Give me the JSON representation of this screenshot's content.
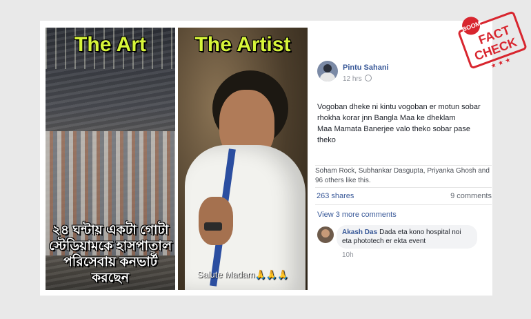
{
  "left_panel": {
    "title": "The Art",
    "caption_line1": "২৪ ঘন্টায় একটা গোটা",
    "caption_line2": "স্টেডিয়ামকে হাসপাতাল",
    "caption_line3": "পরিসেবায় কনভার্ট করছেন"
  },
  "right_panel": {
    "title": "The Artist",
    "caption": "Salute Madam🙏🙏🙏"
  },
  "post": {
    "author": "Pintu Sahani",
    "time": "12 hrs",
    "text_line1": "Vogoban dheke ni kintu vogoban er motun sobar",
    "text_line2": "rhokha korar jnn Bangla Maa ke dheklam",
    "text_line3": "Maa Mamata Banerjee valo theko sobar pase theko",
    "likes_text": "Soham Rock, Subhankar Dasgupta, Priyanka Ghosh and 96 others like this.",
    "shares": "263 shares",
    "comments": "9 comments",
    "view_more": "View 3 more comments"
  },
  "comment": {
    "author": "Akash Das",
    "text": "Dada eta kono hospital noi eta phototech er ekta event",
    "time": "10h"
  },
  "stamp": {
    "brand": "BOOM",
    "word1": "FACT",
    "word2": "CHECK",
    "color": "#d8262f"
  }
}
